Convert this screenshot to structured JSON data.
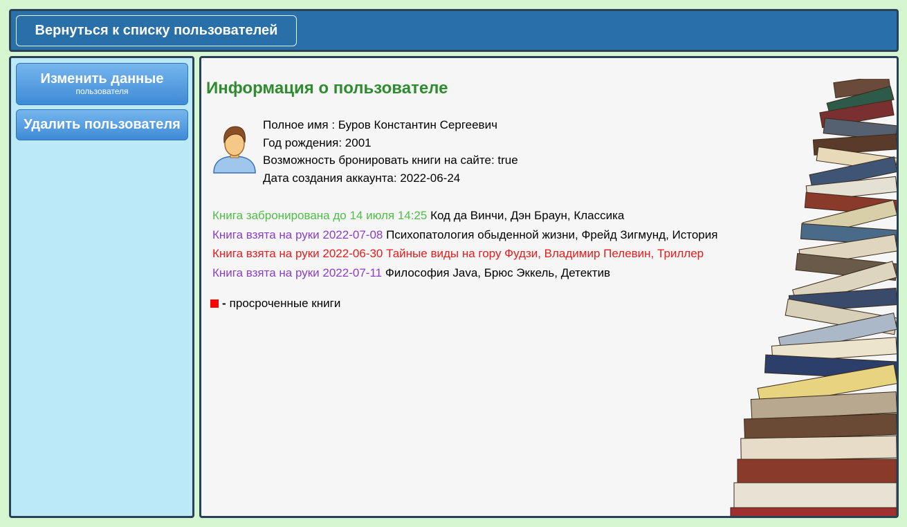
{
  "header": {
    "back_label": "Вернуться к списку пользователей"
  },
  "sidebar": {
    "edit_label": "Изменить данные",
    "edit_sublabel": "пользователя",
    "delete_label": "Удалить пользователя"
  },
  "main": {
    "title": "Информация о пользователе",
    "info": [
      "Полное имя : Буров Константин Сергеевич",
      "Год рождения: 2001",
      "Возможность бронировать книги на сайте: true",
      "Дата создания аккаунта: 2022-06-24"
    ],
    "books": [
      {
        "status": "Книга забронирована до 14 июля 14:25",
        "details": " Код да Винчи, Дэн Браун, Классика",
        "status_color": "green"
      },
      {
        "status": "Книга взята на руки 2022-07-08",
        "details": " Психопатология обыденной жизни, Фрейд Зигмунд, История",
        "status_color": "purple"
      },
      {
        "status": "Книга взята на руки 2022-06-30",
        "details": " Тайные виды на гору Фудзи, Владимир Пелевин, Триллер",
        "status_color": "red"
      },
      {
        "status": "Книга взята на руки 2022-07-11",
        "details": " Философия Java, Брюс Эккель, Детектив",
        "status_color": "purple"
      }
    ],
    "legend": {
      "dash": "-",
      "text": "просроченные книги"
    }
  },
  "colors": {
    "page_bg": "#d4f7d0",
    "header_bg": "#2a70a8",
    "sidebar_bg": "#bbe9f8",
    "title_green": "#2e8b2e",
    "status_green": "#4dbe45",
    "status_purple": "#8a3ec8",
    "status_red": "#ea1a1a"
  }
}
